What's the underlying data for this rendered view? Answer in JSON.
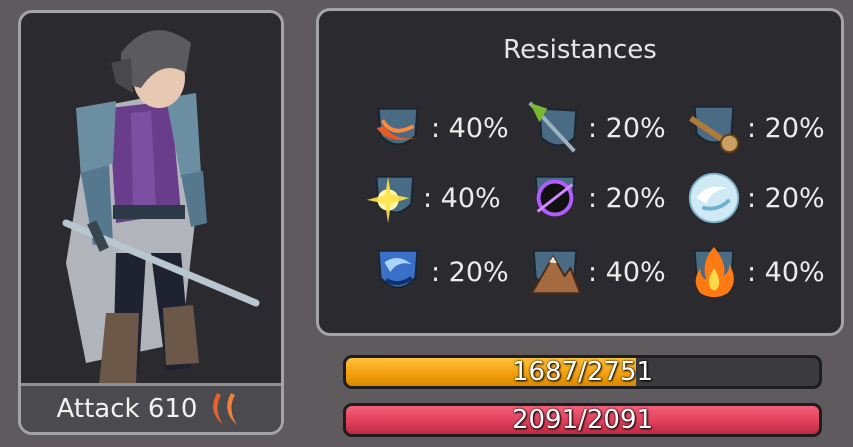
{
  "character": {
    "attack_label": "Attack 610",
    "attack_icon": "slash-claw-icon"
  },
  "resistances": {
    "title": "Resistances",
    "items": [
      {
        "icon": "slash-resistance-icon",
        "value": ": 40%"
      },
      {
        "icon": "pierce-resistance-icon",
        "value": ": 20%"
      },
      {
        "icon": "blunt-resistance-icon",
        "value": ": 20%"
      },
      {
        "icon": "light-resistance-icon",
        "value": ": 40%"
      },
      {
        "icon": "dark-resistance-icon",
        "value": ": 20%"
      },
      {
        "icon": "ice-resistance-icon",
        "value": ": 20%"
      },
      {
        "icon": "water-resistance-icon",
        "value": ": 20%"
      },
      {
        "icon": "earth-resistance-icon",
        "value": ": 40%"
      },
      {
        "icon": "fire-resistance-icon",
        "value": ": 40%"
      }
    ]
  },
  "bars": {
    "experience": {
      "text": "1687/2751",
      "fraction": 0.613,
      "color": "#f4a010"
    },
    "health": {
      "text": "2091/2091",
      "fraction": 1.0,
      "color": "#e0405a"
    }
  }
}
